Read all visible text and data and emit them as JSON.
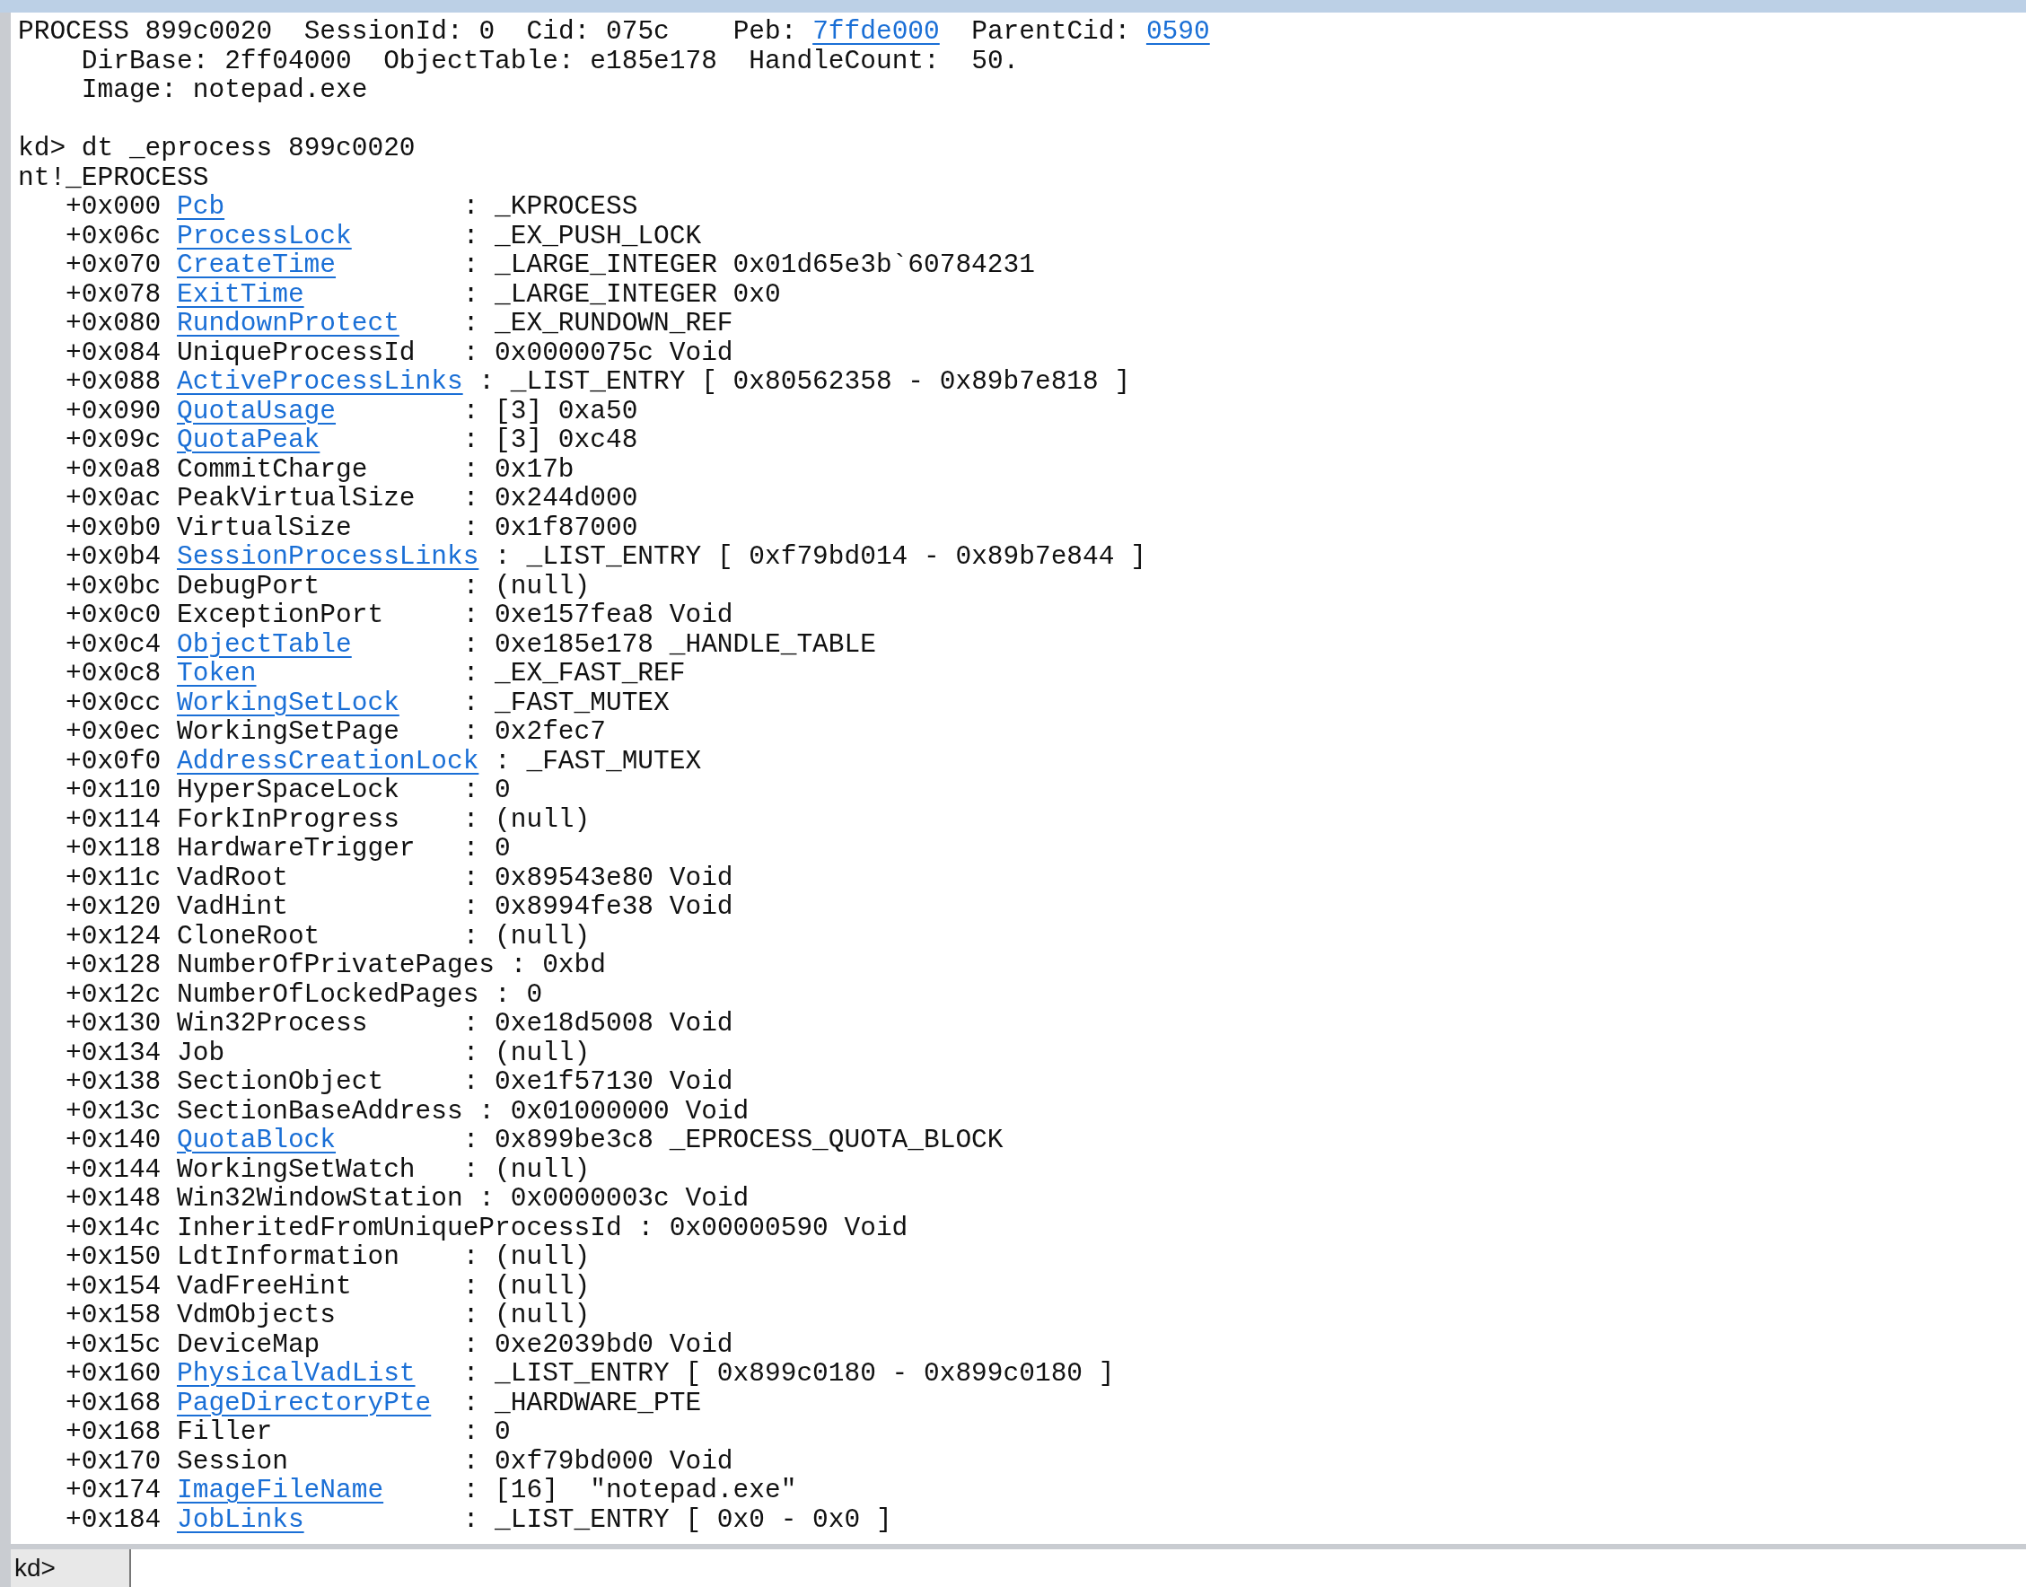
{
  "output": {
    "header_lines": [
      [
        {
          "text": "PROCESS 899c0020  SessionId: 0  Cid: 075c    Peb: ",
          "link": false
        },
        {
          "text": "7ffde000",
          "link": true
        },
        {
          "text": "  ParentCid: ",
          "link": false
        },
        {
          "text": "0590",
          "link": true
        }
      ],
      [
        {
          "text": "    DirBase: 2ff04000  ObjectTable: e185e178  HandleCount:  50.",
          "link": false
        }
      ],
      [
        {
          "text": "    Image: notepad.exe",
          "link": false
        }
      ]
    ],
    "command": "kd> dt _eprocess 899c0020",
    "type_name": "nt!_EPROCESS",
    "fields": [
      {
        "offset": "+0x000",
        "name": "Pcb",
        "link": true,
        "value": ": _KPROCESS"
      },
      {
        "offset": "+0x06c",
        "name": "ProcessLock",
        "link": true,
        "value": ": _EX_PUSH_LOCK"
      },
      {
        "offset": "+0x070",
        "name": "CreateTime",
        "link": true,
        "value": ": _LARGE_INTEGER 0x01d65e3b`60784231"
      },
      {
        "offset": "+0x078",
        "name": "ExitTime",
        "link": true,
        "value": ": _LARGE_INTEGER 0x0"
      },
      {
        "offset": "+0x080",
        "name": "RundownProtect",
        "link": true,
        "value": ": _EX_RUNDOWN_REF"
      },
      {
        "offset": "+0x084",
        "name": "UniqueProcessId",
        "link": false,
        "value": ": 0x0000075c Void"
      },
      {
        "offset": "+0x088",
        "name": "ActiveProcessLinks",
        "link": true,
        "value": ": _LIST_ENTRY [ 0x80562358 - 0x89b7e818 ]"
      },
      {
        "offset": "+0x090",
        "name": "QuotaUsage",
        "link": true,
        "value": ": [3] 0xa50"
      },
      {
        "offset": "+0x09c",
        "name": "QuotaPeak",
        "link": true,
        "value": ": [3] 0xc48"
      },
      {
        "offset": "+0x0a8",
        "name": "CommitCharge",
        "link": false,
        "value": ": 0x17b"
      },
      {
        "offset": "+0x0ac",
        "name": "PeakVirtualSize",
        "link": false,
        "value": ": 0x244d000"
      },
      {
        "offset": "+0x0b0",
        "name": "VirtualSize",
        "link": false,
        "value": ": 0x1f87000"
      },
      {
        "offset": "+0x0b4",
        "name": "SessionProcessLinks",
        "link": true,
        "value": ": _LIST_ENTRY [ 0xf79bd014 - 0x89b7e844 ]"
      },
      {
        "offset": "+0x0bc",
        "name": "DebugPort",
        "link": false,
        "value": ": (null)"
      },
      {
        "offset": "+0x0c0",
        "name": "ExceptionPort",
        "link": false,
        "value": ": 0xe157fea8 Void"
      },
      {
        "offset": "+0x0c4",
        "name": "ObjectTable",
        "link": true,
        "value": ": 0xe185e178 _HANDLE_TABLE"
      },
      {
        "offset": "+0x0c8",
        "name": "Token",
        "link": true,
        "value": ": _EX_FAST_REF"
      },
      {
        "offset": "+0x0cc",
        "name": "WorkingSetLock",
        "link": true,
        "value": ": _FAST_MUTEX"
      },
      {
        "offset": "+0x0ec",
        "name": "WorkingSetPage",
        "link": false,
        "value": ": 0x2fec7"
      },
      {
        "offset": "+0x0f0",
        "name": "AddressCreationLock",
        "link": true,
        "value": ": _FAST_MUTEX"
      },
      {
        "offset": "+0x110",
        "name": "HyperSpaceLock",
        "link": false,
        "value": ": 0"
      },
      {
        "offset": "+0x114",
        "name": "ForkInProgress",
        "link": false,
        "value": ": (null)"
      },
      {
        "offset": "+0x118",
        "name": "HardwareTrigger",
        "link": false,
        "value": ": 0"
      },
      {
        "offset": "+0x11c",
        "name": "VadRoot",
        "link": false,
        "value": ": 0x89543e80 Void"
      },
      {
        "offset": "+0x120",
        "name": "VadHint",
        "link": false,
        "value": ": 0x8994fe38 Void"
      },
      {
        "offset": "+0x124",
        "name": "CloneRoot",
        "link": false,
        "value": ": (null)"
      },
      {
        "offset": "+0x128",
        "name": "NumberOfPrivatePages",
        "link": false,
        "value": ": 0xbd"
      },
      {
        "offset": "+0x12c",
        "name": "NumberOfLockedPages",
        "link": false,
        "value": ": 0"
      },
      {
        "offset": "+0x130",
        "name": "Win32Process",
        "link": false,
        "value": ": 0xe18d5008 Void"
      },
      {
        "offset": "+0x134",
        "name": "Job",
        "link": false,
        "value": ": (null)"
      },
      {
        "offset": "+0x138",
        "name": "SectionObject",
        "link": false,
        "value": ": 0xe1f57130 Void"
      },
      {
        "offset": "+0x13c",
        "name": "SectionBaseAddress",
        "link": false,
        "value": ": 0x01000000 Void"
      },
      {
        "offset": "+0x140",
        "name": "QuotaBlock",
        "link": true,
        "value": ": 0x899be3c8 _EPROCESS_QUOTA_BLOCK"
      },
      {
        "offset": "+0x144",
        "name": "WorkingSetWatch",
        "link": false,
        "value": ": (null)"
      },
      {
        "offset": "+0x148",
        "name": "Win32WindowStation",
        "link": false,
        "value": ": 0x0000003c Void"
      },
      {
        "offset": "+0x14c",
        "name": "InheritedFromUniqueProcessId",
        "link": false,
        "value": ": 0x00000590 Void"
      },
      {
        "offset": "+0x150",
        "name": "LdtInformation",
        "link": false,
        "value": ": (null)"
      },
      {
        "offset": "+0x154",
        "name": "VadFreeHint",
        "link": false,
        "value": ": (null)"
      },
      {
        "offset": "+0x158",
        "name": "VdmObjects",
        "link": false,
        "value": ": (null)"
      },
      {
        "offset": "+0x15c",
        "name": "DeviceMap",
        "link": false,
        "value": ": 0xe2039bd0 Void"
      },
      {
        "offset": "+0x160",
        "name": "PhysicalVadList",
        "link": true,
        "value": ": _LIST_ENTRY [ 0x899c0180 - 0x899c0180 ]"
      },
      {
        "offset": "+0x168",
        "name": "PageDirectoryPte",
        "link": true,
        "value": ": _HARDWARE_PTE"
      },
      {
        "offset": "+0x168",
        "name": "Filler",
        "link": false,
        "value": ": 0"
      },
      {
        "offset": "+0x170",
        "name": "Session",
        "link": false,
        "value": ": 0xf79bd000 Void"
      },
      {
        "offset": "+0x174",
        "name": "ImageFileName",
        "link": true,
        "value": ": [16]  \"notepad.exe\""
      },
      {
        "offset": "+0x184",
        "name": "JobLinks",
        "link": true,
        "value": ": _LIST_ENTRY [ 0x0 - 0x0 ]"
      }
    ]
  },
  "command_bar": {
    "prompt": "kd>"
  }
}
